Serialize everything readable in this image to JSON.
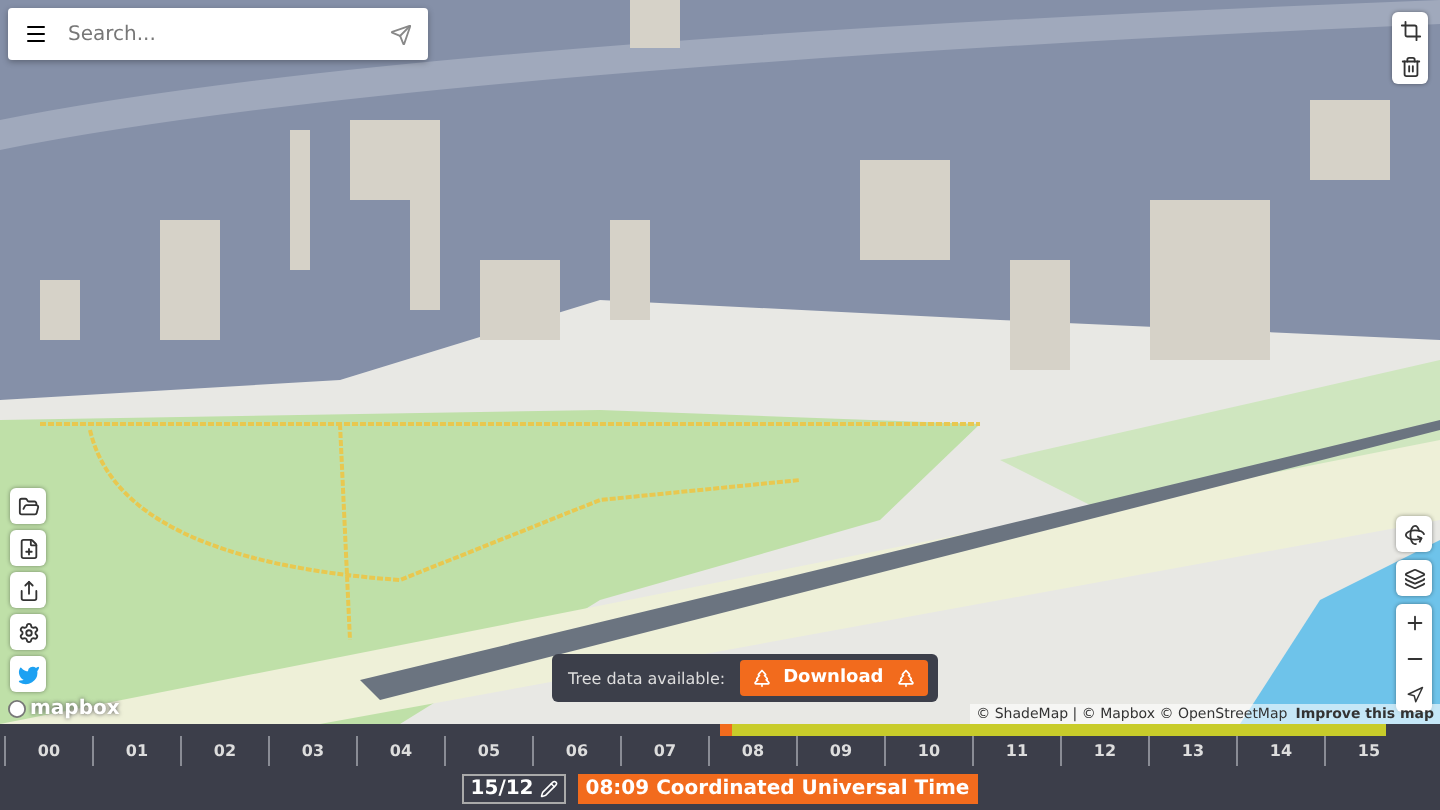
{
  "search": {
    "placeholder": "Search..."
  },
  "attribution": {
    "text": "© ShadeMap | © Mapbox © OpenStreetMap",
    "link": "Improve this map"
  },
  "map_logo": "mapbox",
  "tree_popup": {
    "label": "Tree data available:",
    "button": "Download"
  },
  "timeline": {
    "level": 0.5,
    "hours": [
      "00",
      "01",
      "02",
      "03",
      "04",
      "05",
      "06",
      "07",
      "08",
      "09",
      "10",
      "11",
      "12",
      "13",
      "14",
      "15"
    ],
    "date": "15/12",
    "time": "08:09 Coordinated Universal Time"
  }
}
